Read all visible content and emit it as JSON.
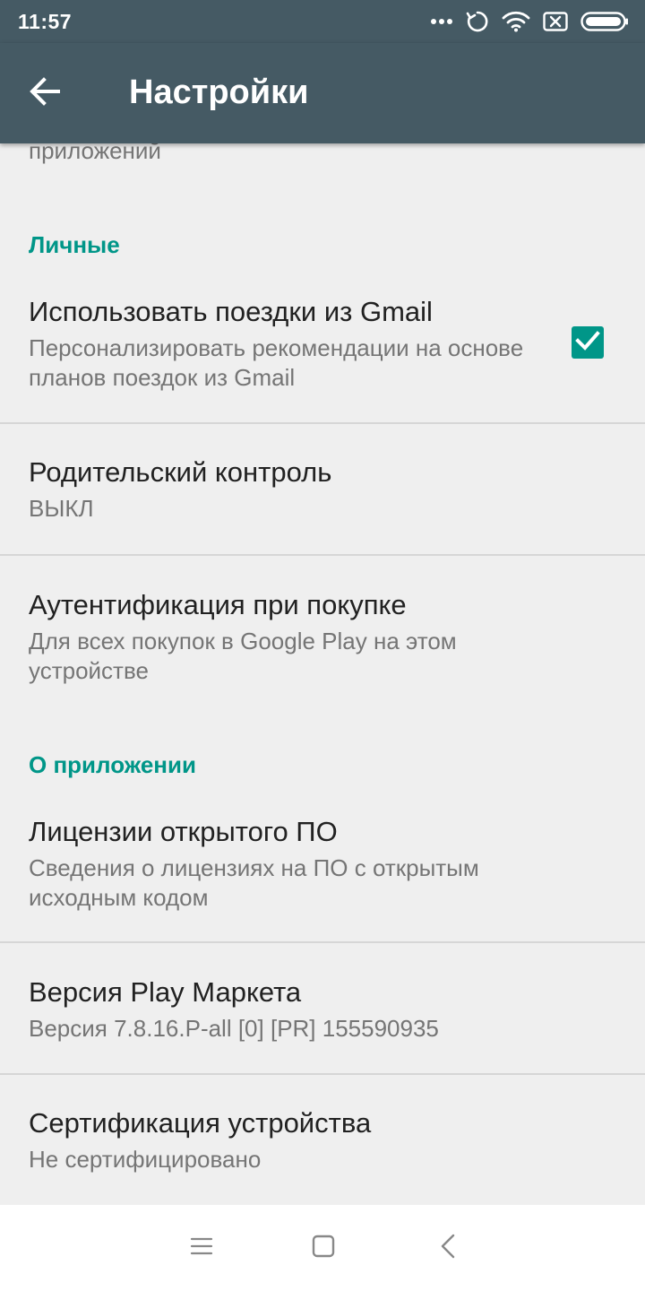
{
  "status_bar": {
    "time": "11:57",
    "icons": [
      "more-dots-icon",
      "sync-icon",
      "wifi-icon",
      "sim-off-icon",
      "battery-icon"
    ]
  },
  "toolbar": {
    "back_icon": "arrow-back-icon",
    "title": "Настройки"
  },
  "settings": {
    "partial_top_text": "приложений",
    "personal_header": "Личные",
    "gmail_trips": {
      "title": "Использовать поездки из Gmail",
      "summary": "Персонализировать рекомендации на основе планов поездок из Gmail",
      "checked": true
    },
    "parental_control": {
      "title": "Родительский контроль",
      "summary": "ВЫКЛ"
    },
    "purchase_auth": {
      "title": "Аутентификация при покупке",
      "summary": "Для всех покупок в Google Play на этом устройстве"
    },
    "about_header": "О приложении",
    "licenses": {
      "title": "Лицензии открытого ПО",
      "summary": "Сведения о лицензиях на ПО с открытым исходным кодом"
    },
    "version": {
      "title": "Версия Play Маркета",
      "summary": "Версия 7.8.16.P-all [0] [PR] 155590935"
    },
    "certification": {
      "title": "Сертификация устройства",
      "summary": "Не сертифицировано"
    }
  },
  "nav_bar": {
    "icons": [
      "menu-icon",
      "home-icon",
      "back-icon"
    ]
  },
  "colors": {
    "toolbar": "#455a64",
    "accent": "#009688",
    "background": "#efefef"
  }
}
